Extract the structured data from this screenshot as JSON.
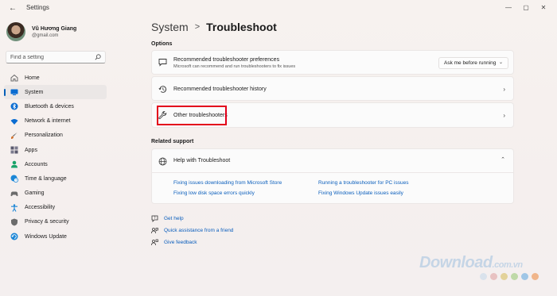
{
  "window": {
    "app_title": "Settings",
    "back_glyph": "←",
    "min_glyph": "—",
    "max_glyph": "▢",
    "close_glyph": "✕"
  },
  "user": {
    "name": "Vũ Hương Giang",
    "email": "@gmail.com"
  },
  "search": {
    "placeholder": "Find a setting"
  },
  "sidebar": {
    "items": [
      {
        "label": "Home",
        "icon": "home-icon",
        "color": "#6b6b6b"
      },
      {
        "label": "System",
        "icon": "system-icon",
        "color": "#0a6cd1",
        "active": true
      },
      {
        "label": "Bluetooth & devices",
        "icon": "bluetooth-icon",
        "color": "#0a6cd1"
      },
      {
        "label": "Network & internet",
        "icon": "wifi-icon",
        "color": "#0a6cd1"
      },
      {
        "label": "Personalization",
        "icon": "brush-icon",
        "color": "#d0702a"
      },
      {
        "label": "Apps",
        "icon": "apps-icon",
        "color": "#5a5a6e"
      },
      {
        "label": "Accounts",
        "icon": "person-icon",
        "color": "#1aa36a"
      },
      {
        "label": "Time & language",
        "icon": "globe-clock-icon",
        "color": "#1b86d6"
      },
      {
        "label": "Gaming",
        "icon": "controller-icon",
        "color": "#6b6b6b"
      },
      {
        "label": "Accessibility",
        "icon": "accessibility-icon",
        "color": "#1b86d6"
      },
      {
        "label": "Privacy & security",
        "icon": "shield-icon",
        "color": "#6b6b6b"
      },
      {
        "label": "Windows Update",
        "icon": "update-icon",
        "color": "#1b86d6"
      }
    ]
  },
  "breadcrumb": {
    "parent": "System",
    "separator": ">",
    "current": "Troubleshoot"
  },
  "options": {
    "label": "Options",
    "preferences": {
      "title": "Recommended troubleshooter preferences",
      "subtitle": "Microsoft can recommend and run troubleshooters to fix issues",
      "dropdown_value": "Ask me before running"
    },
    "history": {
      "title": "Recommended troubleshooter history"
    },
    "other": {
      "title": "Other troubleshooters"
    }
  },
  "related": {
    "label": "Related support",
    "help_title": "Help with Troubleshoot",
    "links": [
      "Fixing issues downloading from Microsoft Store",
      "Running a troubleshooter for PC issues",
      "Fixing low disk space errors quickly",
      "Fixing Windows Update issues easily"
    ]
  },
  "footer": {
    "get_help": "Get help",
    "quick_assist": "Quick assistance from a friend",
    "feedback": "Give feedback"
  },
  "watermark": {
    "brand": "Download",
    "tld": ".com.vn",
    "dot_colors": [
      "#d9e2ec",
      "#e8c2c2",
      "#e3d29a",
      "#bfd9a8",
      "#9fc6e6",
      "#f0b58a"
    ]
  },
  "colors": {
    "accent": "#005fb8",
    "link": "#0a5ebc",
    "highlight": "#e3001b"
  }
}
